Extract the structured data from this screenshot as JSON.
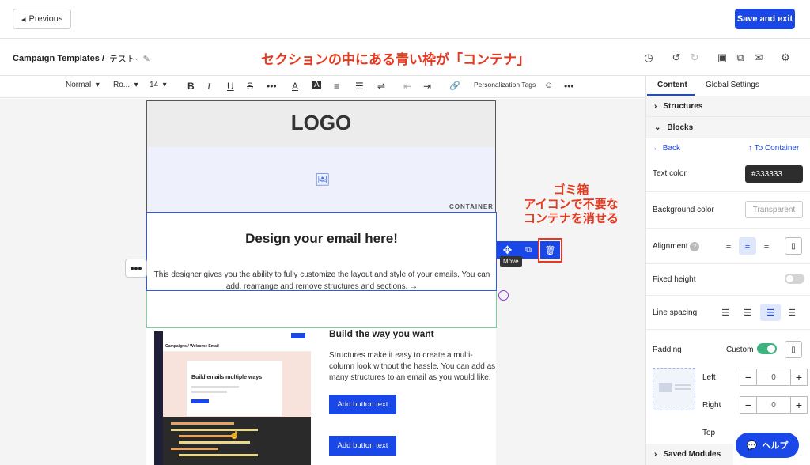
{
  "header": {
    "previous_label": "Previous",
    "save_label": "Save and exit"
  },
  "breadcrumb": {
    "root": "Campaign Templates /",
    "current": "テスト·"
  },
  "annotations": {
    "top": "セクションの中にある青い枠が「コンテナ」",
    "side": "ゴミ箱\nアイコンで不要な\nコンテナを消せる"
  },
  "toolbar": {
    "style": "Normal",
    "font": "Ro...",
    "size": "14",
    "personalization": "Personalization Tags"
  },
  "canvas": {
    "logo": "LOGO",
    "container_tag": "CONTAINER",
    "heading": "Design your email here!",
    "paragraph": "This designer gives you the ability to fully customize the layout and style of your emails. You can add, rearrange and remove structures and sections. →",
    "move_tooltip": "Move",
    "preview_header": "Campaigns / Welcome Email",
    "preview_title": "Build emails multiple ways",
    "build_heading": "Build the way you want",
    "build_paragraph": "Structures make it easy to create a multi- column look without the hassle. You can add as many structures to an email as you would like.",
    "button1": "Add button text",
    "button2": "Add button text"
  },
  "panel": {
    "tab_content": "Content",
    "tab_global": "Global Settings",
    "structures": "Structures",
    "blocks": "Blocks",
    "back": "Back",
    "to_container": "To Container",
    "text_color_label": "Text color",
    "text_color_value": "#333333",
    "bg_color_label": "Background color",
    "bg_color_value": "Transparent",
    "alignment_label": "Alignment",
    "fixed_height_label": "Fixed height",
    "line_spacing_label": "Line spacing",
    "padding_label": "Padding",
    "padding_mode": "Custom",
    "left_label": "Left",
    "left_value": "0",
    "right_label": "Right",
    "right_value": "0",
    "top_label": "Top",
    "saved_modules": "Saved Modules",
    "help": "ヘルプ"
  },
  "colors": {
    "accent": "#1a47e8",
    "annotation": "#e53a1f",
    "toggle_on": "#3fb37f"
  }
}
